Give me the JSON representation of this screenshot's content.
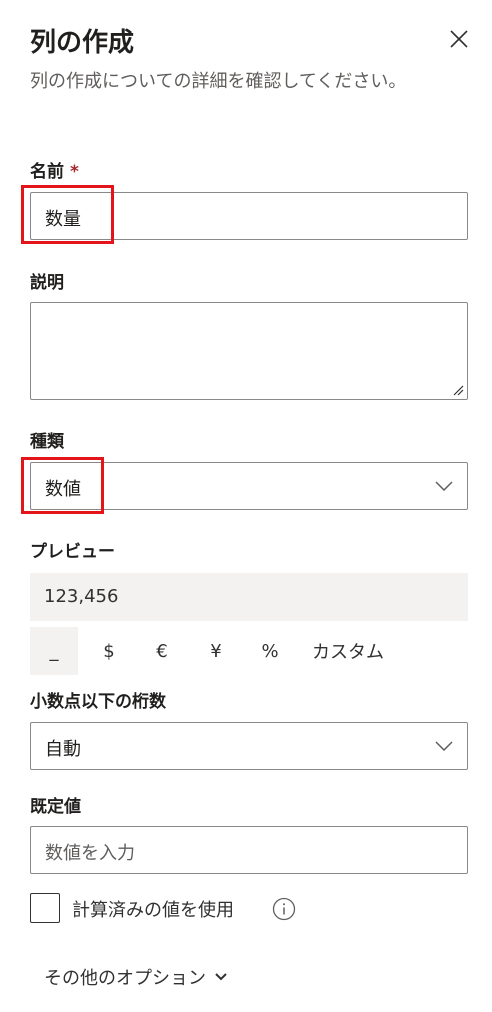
{
  "panel": {
    "title": "列の作成",
    "subtitle": "列の作成についての詳細を確認してください。"
  },
  "name_field": {
    "label": "名前",
    "required_marker": "*",
    "value": "数量"
  },
  "description_field": {
    "label": "説明",
    "value": ""
  },
  "type_field": {
    "label": "種類",
    "selected": "数値"
  },
  "preview": {
    "label": "プレビュー",
    "value": "123,456",
    "format_options": [
      "_",
      "$",
      "€",
      "¥",
      "%",
      "カスタム"
    ],
    "selected_format": "_"
  },
  "decimal_places": {
    "label": "小数点以下の桁数",
    "selected": "自動"
  },
  "default_value": {
    "label": "既定値",
    "placeholder": "数値を入力",
    "value": ""
  },
  "calculated": {
    "label": "計算済みの値を使用",
    "checked": false
  },
  "more_options": {
    "label": "その他のオプション"
  },
  "colors": {
    "highlight": "#e3141a",
    "required": "#a4262c",
    "preview_bg": "#f3f2f1"
  }
}
